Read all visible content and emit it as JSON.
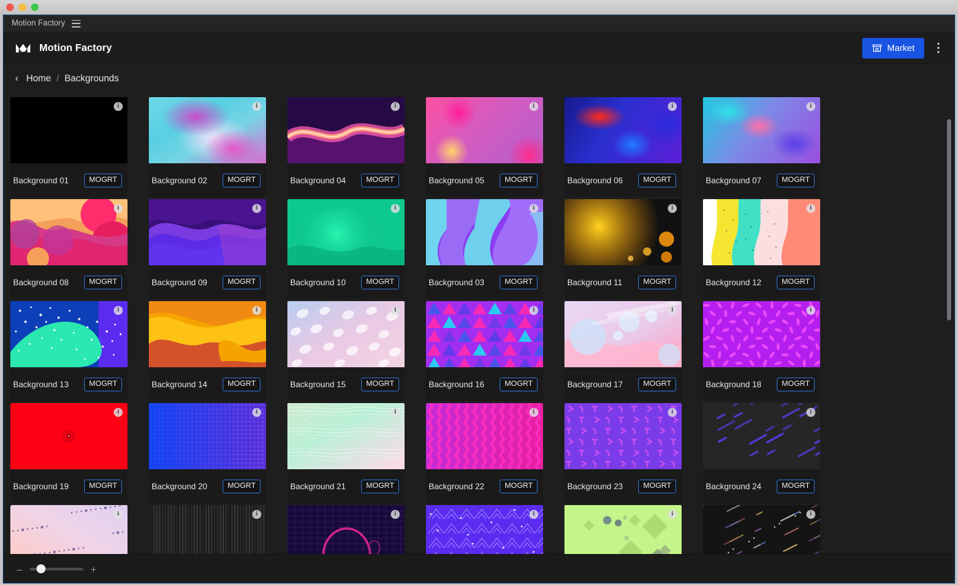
{
  "window": {
    "traffic_lights": [
      "close",
      "minimize",
      "maximize"
    ],
    "panel_tab_title": "Motion Factory",
    "menu_icon": "hamburger-icon"
  },
  "header": {
    "brand_name": "Motion Factory",
    "logo_icon": "motion-factory-logo-icon",
    "market_label": "Market",
    "market_icon": "store-icon",
    "market_color": "#1853e2",
    "overflow_icon": "kebab-menu-icon"
  },
  "breadcrumb": {
    "back_icon": "chevron-left-icon",
    "home_label": "Home",
    "separator": "/",
    "current_label": "Backgrounds"
  },
  "grid": {
    "badge_label": "MOGRT",
    "info_icon": "info-icon",
    "columns": 6,
    "items": [
      {
        "title": "Background 01",
        "badge": "MOGRT",
        "art": "a01"
      },
      {
        "title": "Background 02",
        "badge": "MOGRT",
        "art": "a02"
      },
      {
        "title": "Background 04",
        "badge": "MOGRT",
        "art": "a04"
      },
      {
        "title": "Background 05",
        "badge": "MOGRT",
        "art": "a05"
      },
      {
        "title": "Background 06",
        "badge": "MOGRT",
        "art": "a06"
      },
      {
        "title": "Background 07",
        "badge": "MOGRT",
        "art": "a07"
      },
      {
        "title": "Background 08",
        "badge": "MOGRT",
        "art": "a08"
      },
      {
        "title": "Background 09",
        "badge": "MOGRT",
        "art": "a09"
      },
      {
        "title": "Background 10",
        "badge": "MOGRT",
        "art": "a10"
      },
      {
        "title": "Background 03",
        "badge": "MOGRT",
        "art": "a03"
      },
      {
        "title": "Background 11",
        "badge": "MOGRT",
        "art": "a11"
      },
      {
        "title": "Background 12",
        "badge": "MOGRT",
        "art": "a12"
      },
      {
        "title": "Background 13",
        "badge": "MOGRT",
        "art": "a13"
      },
      {
        "title": "Background 14",
        "badge": "MOGRT",
        "art": "a14"
      },
      {
        "title": "Background 15",
        "badge": "MOGRT",
        "art": "a15"
      },
      {
        "title": "Background 16",
        "badge": "MOGRT",
        "art": "a16"
      },
      {
        "title": "Background 17",
        "badge": "MOGRT",
        "art": "a17"
      },
      {
        "title": "Background 18",
        "badge": "MOGRT",
        "art": "a18"
      },
      {
        "title": "Background 19",
        "badge": "MOGRT",
        "art": "a19"
      },
      {
        "title": "Background 20",
        "badge": "MOGRT",
        "art": "a20"
      },
      {
        "title": "Background 21",
        "badge": "MOGRT",
        "art": "a21"
      },
      {
        "title": "Background 22",
        "badge": "MOGRT",
        "art": "a22"
      },
      {
        "title": "Background 23",
        "badge": "MOGRT",
        "art": "a23"
      },
      {
        "title": "Background 24",
        "badge": "MOGRT",
        "art": "a24"
      },
      {
        "title": "",
        "badge": "",
        "art": "a25"
      },
      {
        "title": "",
        "badge": "",
        "art": "a26"
      },
      {
        "title": "",
        "badge": "",
        "art": "a27"
      },
      {
        "title": "",
        "badge": "",
        "art": "a28"
      },
      {
        "title": "",
        "badge": "",
        "art": "a29"
      },
      {
        "title": "",
        "badge": "",
        "art": "a30"
      }
    ]
  },
  "footer": {
    "zoom_out_label": "–",
    "zoom_in_label": "+",
    "zoom_value": 14
  }
}
